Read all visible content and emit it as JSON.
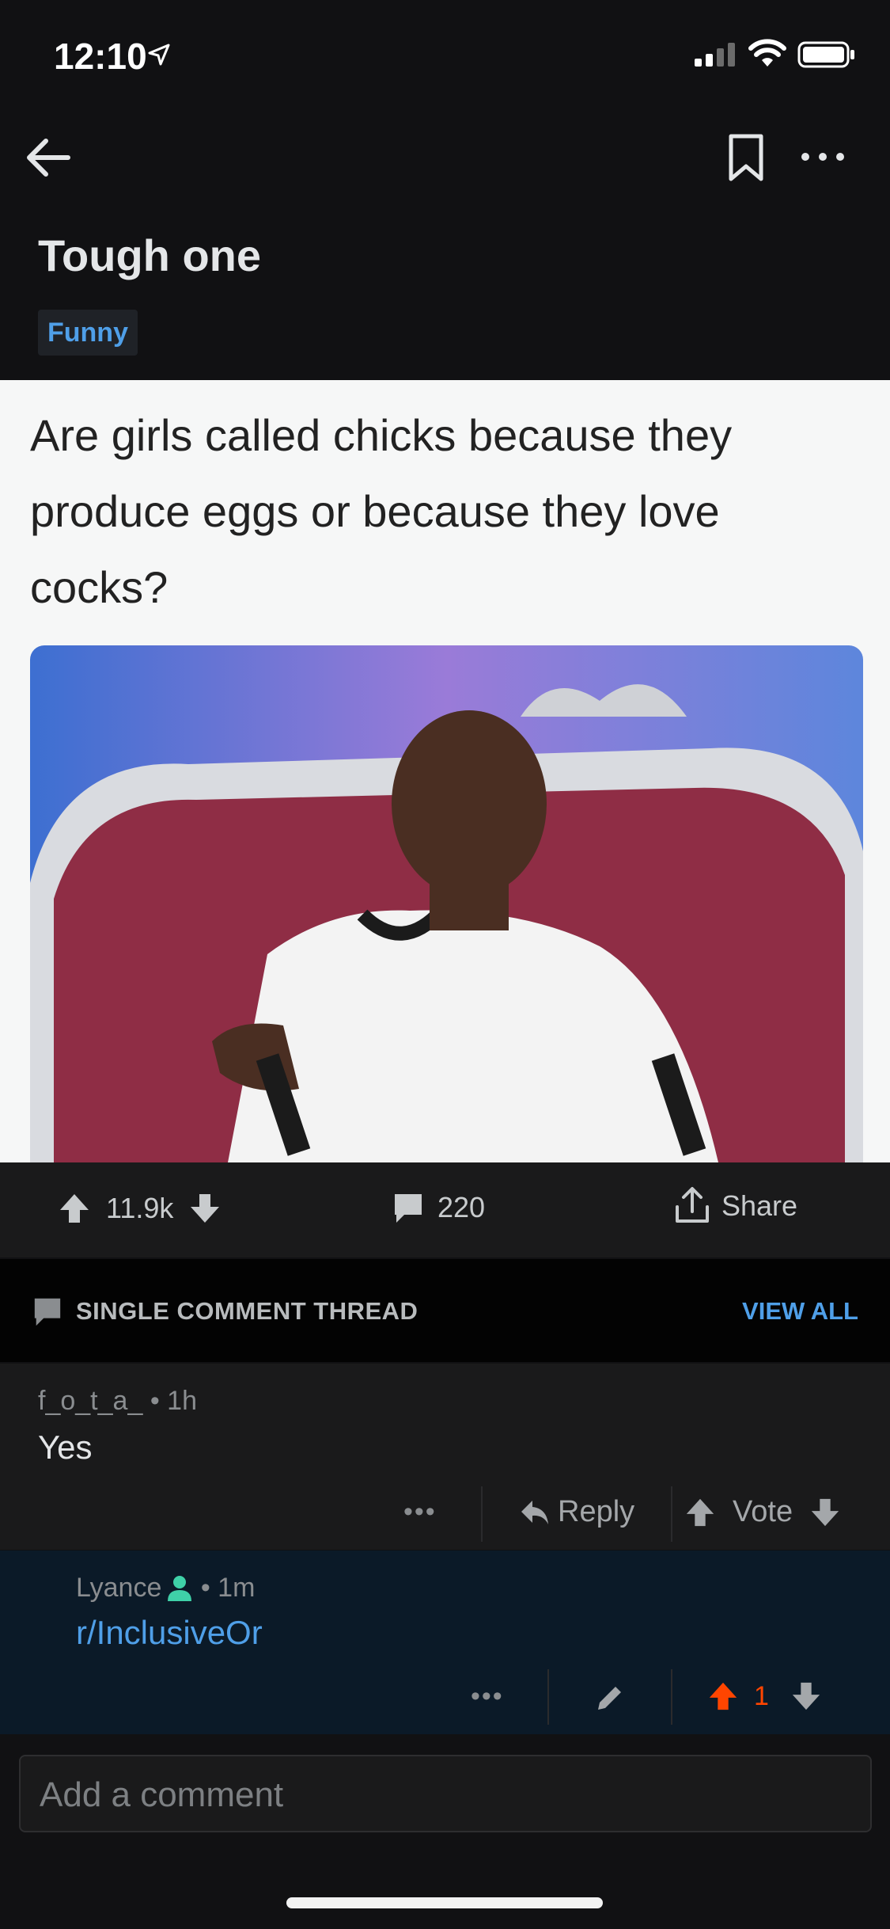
{
  "status_bar": {
    "time": "12:10"
  },
  "post": {
    "title": "Tough one",
    "flair": "Funny",
    "image_text": "Are girls called chicks because they produce eggs or because they love cocks?"
  },
  "actions": {
    "votes": "11.9k",
    "comments": "220",
    "share_label": "Share"
  },
  "thread": {
    "title": "SINGLE COMMENT THREAD",
    "view_all": "VIEW ALL"
  },
  "comments": [
    {
      "author": "f_o_t_a_",
      "age": "1h",
      "body": "Yes",
      "dots": "•••",
      "reply_label": "Reply",
      "vote_label": "Vote"
    },
    {
      "author": "Lyance",
      "age": "1m",
      "body": "r/InclusiveOr",
      "dots": "•••",
      "score": "1"
    }
  ],
  "composer": {
    "placeholder": "Add a comment"
  },
  "colors": {
    "accent_blue": "#4f9fe8",
    "upvote_orange": "#ff4500",
    "nested_bg": "#0b1a28"
  }
}
